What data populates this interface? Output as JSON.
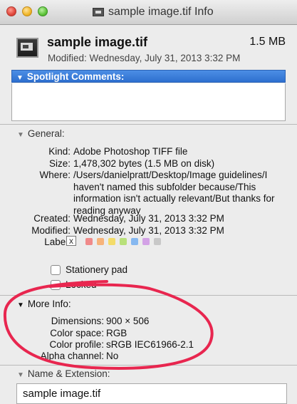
{
  "window": {
    "title": "sample image.tif Info",
    "controls": [
      "close",
      "minimize",
      "zoom"
    ]
  },
  "header": {
    "file_name": "sample image.tif",
    "file_size": "1.5 MB",
    "modified": "Modified: Wednesday, July 31, 2013 3:32 PM",
    "icon": "tiff-file-icon"
  },
  "spotlight": {
    "label": "Spotlight Comments:",
    "value": ""
  },
  "general": {
    "label": "General:",
    "kind_label": "Kind:",
    "kind": "Adobe Photoshop TIFF file",
    "size_label": "Size:",
    "size": "1,478,302 bytes (1.5 MB on disk)",
    "where_label": "Where:",
    "where_lines": [
      "/Users/danielpratt/Desktop/Image guidelines/I",
      "haven't named this subfolder because/This",
      "information isn't actually relevant/But thanks for",
      "reading anyway"
    ],
    "created_label": "Created:",
    "created": "Wednesday, July 31, 2013 3:32 PM",
    "modified_label": "Modified:",
    "modified": "Wednesday, July 31, 2013 3:32 PM",
    "label_label": "Label:",
    "label_none": "x",
    "label_colors": [
      "#f08a8a",
      "#f7b37a",
      "#f4dc6a",
      "#b8e07a",
      "#86b8f0",
      "#d3a2e6",
      "#c8c8c8"
    ],
    "stationery_label": "Stationery pad",
    "locked_label": "Locked",
    "stationery_checked": false,
    "locked_checked": false
  },
  "more_info": {
    "label": "More Info:",
    "dimensions_label": "Dimensions:",
    "dimensions": "900 × 506",
    "color_space_label": "Color space:",
    "color_space": "RGB",
    "color_profile_label": "Color profile:",
    "color_profile": "sRGB IEC61966-2.1",
    "alpha_label": "Alpha channel:",
    "alpha": "No"
  },
  "name_extension": {
    "label": "Name & Extension:",
    "value": "sample image.tif"
  },
  "colors": {
    "highlight_ring": "#e8264f",
    "selection_blue": "#3a7bd9"
  }
}
